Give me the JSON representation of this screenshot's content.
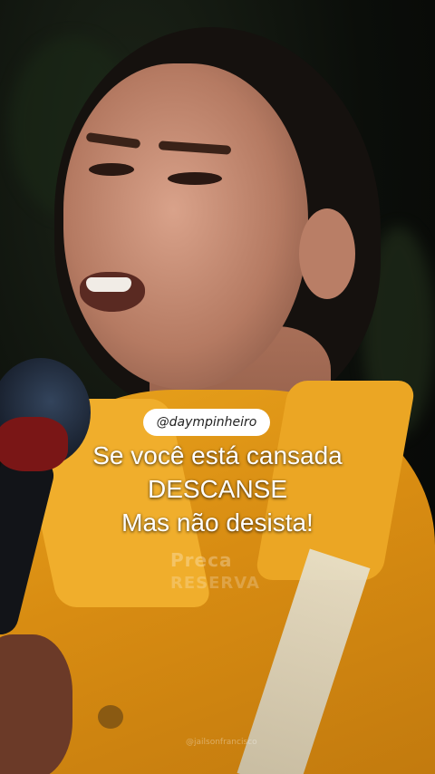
{
  "overlay": {
    "handle": "@daympinheiro",
    "caption_lines": [
      "Se você está cansada",
      "DESCANSE",
      "Mas não desista!"
    ],
    "watermark_line1": "Preca",
    "watermark_line2": "RESERVA",
    "credit": "@jailsonfrancisco"
  },
  "colors": {
    "shirt": "#e8a21c",
    "caption_text": "#ffffff",
    "pill_background": "#ffffff"
  }
}
